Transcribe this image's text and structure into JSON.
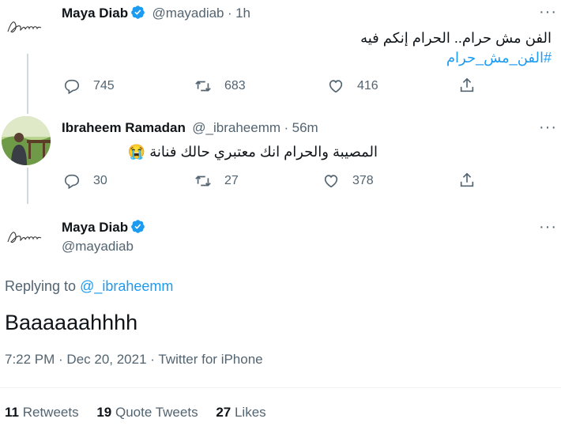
{
  "tweet1": {
    "name": "Maya Diab",
    "handle": "@mayadiab",
    "sep": "·",
    "time": "1h",
    "text": "الفن مش حرام..  الحرام إنكم فيه",
    "hashtag": "#الفن_مش_حرام",
    "replies": "745",
    "retweets": "683",
    "likes": "416"
  },
  "tweet2": {
    "name": "Ibraheem Ramadan",
    "handle": "@_ibraheemm",
    "sep": "·",
    "time": "56m",
    "text": "المصيبة والحرام انك معتبري حالك فنانة",
    "emoji": "😭",
    "replies": "30",
    "retweets": "27",
    "likes": "378"
  },
  "tweet3": {
    "name": "Maya Diab",
    "handle": "@mayadiab",
    "replying_prefix": "Replying to",
    "replying_handle": "@_ibraheemm",
    "text": "Baaaaaahhhh",
    "timestamp": "7:22 PM · Dec 20, 2021 · Twitter for iPhone",
    "retweets_count": "11",
    "retweets_label": "Retweets",
    "quotes_count": "19",
    "quotes_label": "Quote Tweets",
    "likes_count": "27",
    "likes_label": "Likes"
  },
  "more_glyph": "···",
  "colors": {
    "accent": "#1d9bf0",
    "muted": "#536471",
    "text": "#0f1419",
    "line": "#cfd9de"
  }
}
